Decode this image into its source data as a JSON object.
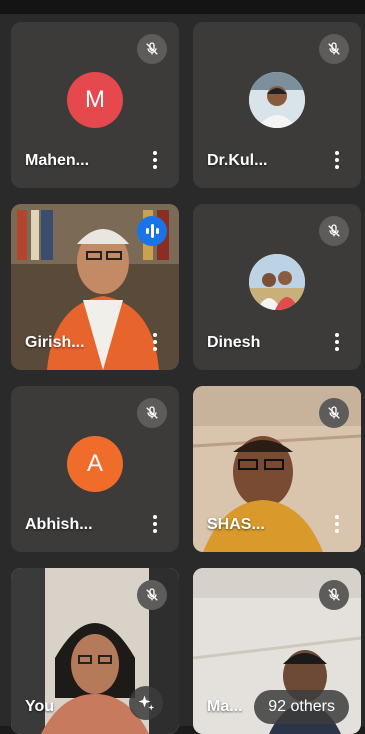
{
  "participants": [
    {
      "name": "Mahen...",
      "initial": "M",
      "avatar_color": "#e5484d"
    },
    {
      "name": "Dr.Kul..."
    },
    {
      "name": "Girish..."
    },
    {
      "name": "Dinesh"
    },
    {
      "name": "Abhish...",
      "initial": "A",
      "avatar_color": "#ef6c2b"
    },
    {
      "name": "SHAS..."
    },
    {
      "name": "You"
    },
    {
      "name": "Ma..."
    }
  ],
  "others_label": "92 others",
  "icons": {
    "muted": "mic-off-icon",
    "speaking": "speaking-indicator-icon",
    "more": "more-options-icon",
    "effects": "sparkle-effects-icon"
  },
  "colors": {
    "tile_bg": "#3c3b3a",
    "speaking": "#1a73e8"
  }
}
